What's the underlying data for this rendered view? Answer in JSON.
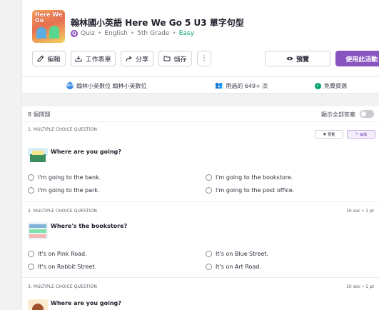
{
  "activity": {
    "title": "翰林國小英語 Here We Go 5 U3 單字句型",
    "type": "Quiz",
    "subject": "English",
    "grade": "5th Grade",
    "difficulty": "Easy",
    "cover_text": "Here We Go"
  },
  "toolbar": {
    "edit_label": "編輯",
    "worksheet_label": "工作表單",
    "share_label": "分享",
    "save_label": "儲存",
    "more_label": "⋮",
    "preview_label": "預覽",
    "use_label": "使用此活動"
  },
  "info": {
    "owner_badge": "翰林",
    "owner": "翰林小英數位 翰林小英數位",
    "played": "用過的 649+ 次",
    "free": "免費資源"
  },
  "questions_header": {
    "count": "8 個問題",
    "show_answers": "顯示全部答案"
  },
  "questions": [
    {
      "type": "1. MULTIPLE CHOICE QUESTION",
      "text": "Where are you going?",
      "preview_label": "預覽",
      "edit_label": "編輯",
      "options": [
        "I'm going to the bank.",
        "I'm going to the bookstore.",
        "I'm going to the park.",
        "I'm going to the post office."
      ]
    },
    {
      "type": "2. MULTIPLE CHOICE QUESTION",
      "meta": "10 sec • 1 pt",
      "text": "Where's the bookstore?",
      "options": [
        "It's on Pink Road.",
        "It's on Blue Street.",
        "It's on Rabbit Street.",
        "It's on Art Road."
      ]
    },
    {
      "type": "3. MULTIPLE CHOICE QUESTION",
      "meta": "10 sec • 1 pt",
      "text": "Where are you going?"
    }
  ],
  "colors": {
    "brand_purple": "#8854c0",
    "easy_green": "#00a06b",
    "page_bg": "#f2f2f2"
  }
}
